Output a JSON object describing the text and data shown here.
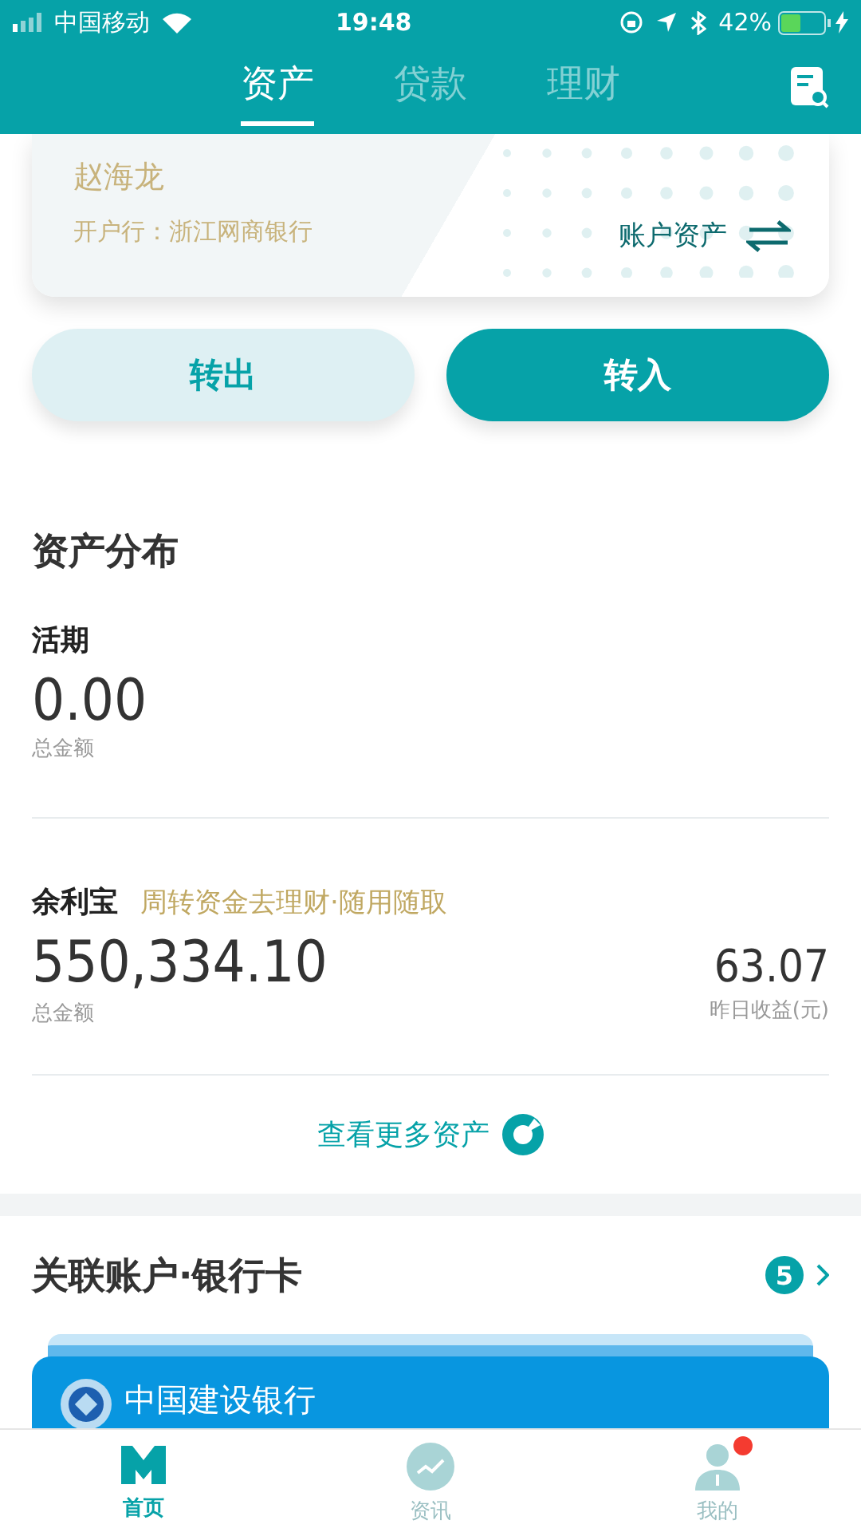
{
  "status_bar": {
    "carrier": "中国移动",
    "time": "19:48",
    "battery": "42%"
  },
  "tabs": [
    {
      "label": "资产",
      "selected": true
    },
    {
      "label": "贷款",
      "selected": false
    },
    {
      "label": "理财",
      "selected": false
    }
  ],
  "account_card": {
    "name": "赵海龙",
    "bank": "开户行：浙江网商银行",
    "switch_label": "账户资产"
  },
  "actions": [
    {
      "label": "转出",
      "kind": "secondary"
    },
    {
      "label": "转入",
      "kind": "primary"
    }
  ],
  "asset_section": {
    "title": "资产分布",
    "items": [
      {
        "name": "活期",
        "amount": "0.00",
        "amount_label": "总金额"
      },
      {
        "name": "余利宝",
        "tagline": "周转资金去理财·随用随取",
        "amount": "550,334.10",
        "amount_label": "总金额",
        "yield": "63.07",
        "yield_label": "昨日收益(元)"
      }
    ],
    "more_link": "查看更多资产"
  },
  "linked_section": {
    "title": "关联账户·银行卡",
    "count": "5",
    "cards": [
      {
        "bank": "中国建设银行"
      }
    ]
  },
  "bottom_nav": [
    {
      "label": "首页",
      "selected": true,
      "badge": false
    },
    {
      "label": "资讯",
      "selected": false,
      "badge": false
    },
    {
      "label": "我的",
      "selected": false,
      "badge": true
    }
  ]
}
